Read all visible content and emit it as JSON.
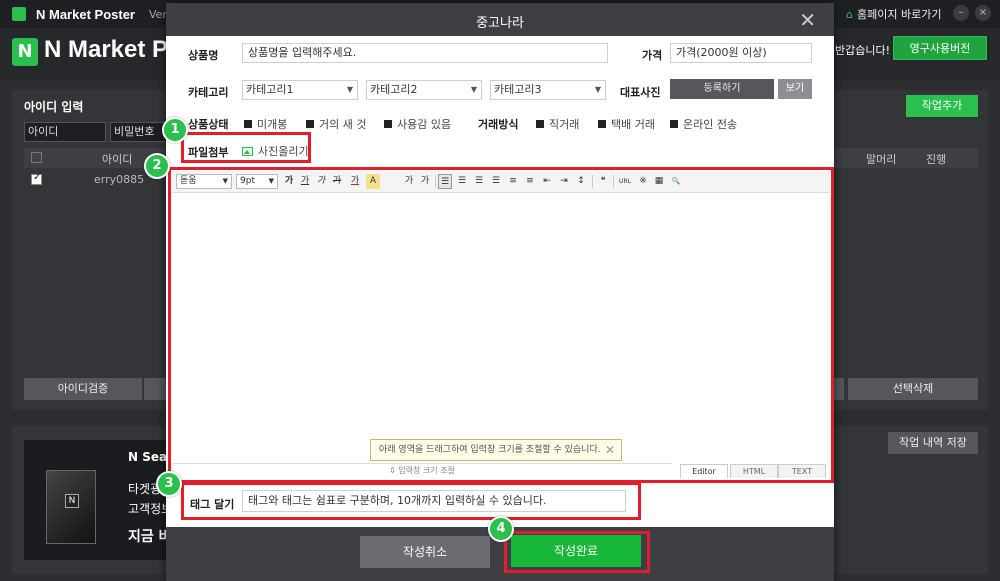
{
  "app": {
    "title": "N Market Poster",
    "version": "Ver",
    "home_link": "홈페이지 바로가기",
    "big_title": "N Market Post",
    "welcome": "반갑습니다!",
    "permanent_btn": "영구사용버전",
    "min_icon": "–",
    "close_icon": "×"
  },
  "panel": {
    "title": "아이디 입력",
    "add_job": "작업추가",
    "id_input": "아이디",
    "pw_input": "비밀번호",
    "grid_headers": {
      "id": "아이디",
      "header_col": "말머리",
      "progress": "진행"
    },
    "rows": [
      {
        "id": "erry0885"
      }
    ],
    "verify_btn": "아이디검증",
    "delete_btn": "선택삭제"
  },
  "panel2": {
    "save_log": "작업 내역 저장",
    "ad_lines": [
      "N Searc",
      "타겟광고",
      "고객정보",
      "지금 바로"
    ],
    "badge": "N"
  },
  "modal": {
    "title": "중고나라",
    "close": "✕",
    "labels": {
      "product_name": "상품명",
      "price": "가격",
      "category": "카테고리",
      "main_photo": "대표사진",
      "condition": "상품상태",
      "trade_method": "거래방식",
      "attachment": "파일첨부",
      "tags": "태그 달기"
    },
    "product_name_placeholder": "상품명을 입력해주세요.",
    "price_placeholder": "가격(2000원 이상)",
    "categories": [
      "카테고리1",
      "카테고리2",
      "카테고리3"
    ],
    "register_btn": "등록하기",
    "view_btn": "보기",
    "conditions": [
      "미개봉",
      "거의 새 것",
      "사용감 있음"
    ],
    "trade_methods": [
      "직거래",
      "택배 거래",
      "온라인 전송"
    ],
    "upload_photo": "사진올리기",
    "tags_placeholder": "태그와 태그는 쉼표로 구분하며, 10개까지 입력하실 수 있습니다.",
    "cancel": "작성취소",
    "done": "작성완료"
  },
  "editor": {
    "font": "돋움",
    "size": "9pt",
    "resize_hint": "아래 영역을 드래그하여 입력창 크기를 조절할 수 있습니다.",
    "resize_bar": "⇕ 입력창 크기 조절",
    "tabs": [
      "Editor",
      "HTML",
      "TEXT"
    ],
    "glyphs": {
      "bold": "가",
      "underline": "가",
      "italic": "가",
      "strike": "가",
      "fontcolor": "가",
      "bgcolor": "A",
      "sup": "가",
      "sub": "가",
      "quote": "❝",
      "url": "URL",
      "special": "※",
      "table": "▦",
      "find": "🔍"
    }
  },
  "steps": [
    "1",
    "2",
    "3",
    "4"
  ],
  "colors": {
    "accent": "#2bbf4e",
    "highlight": "#e31d2b"
  }
}
